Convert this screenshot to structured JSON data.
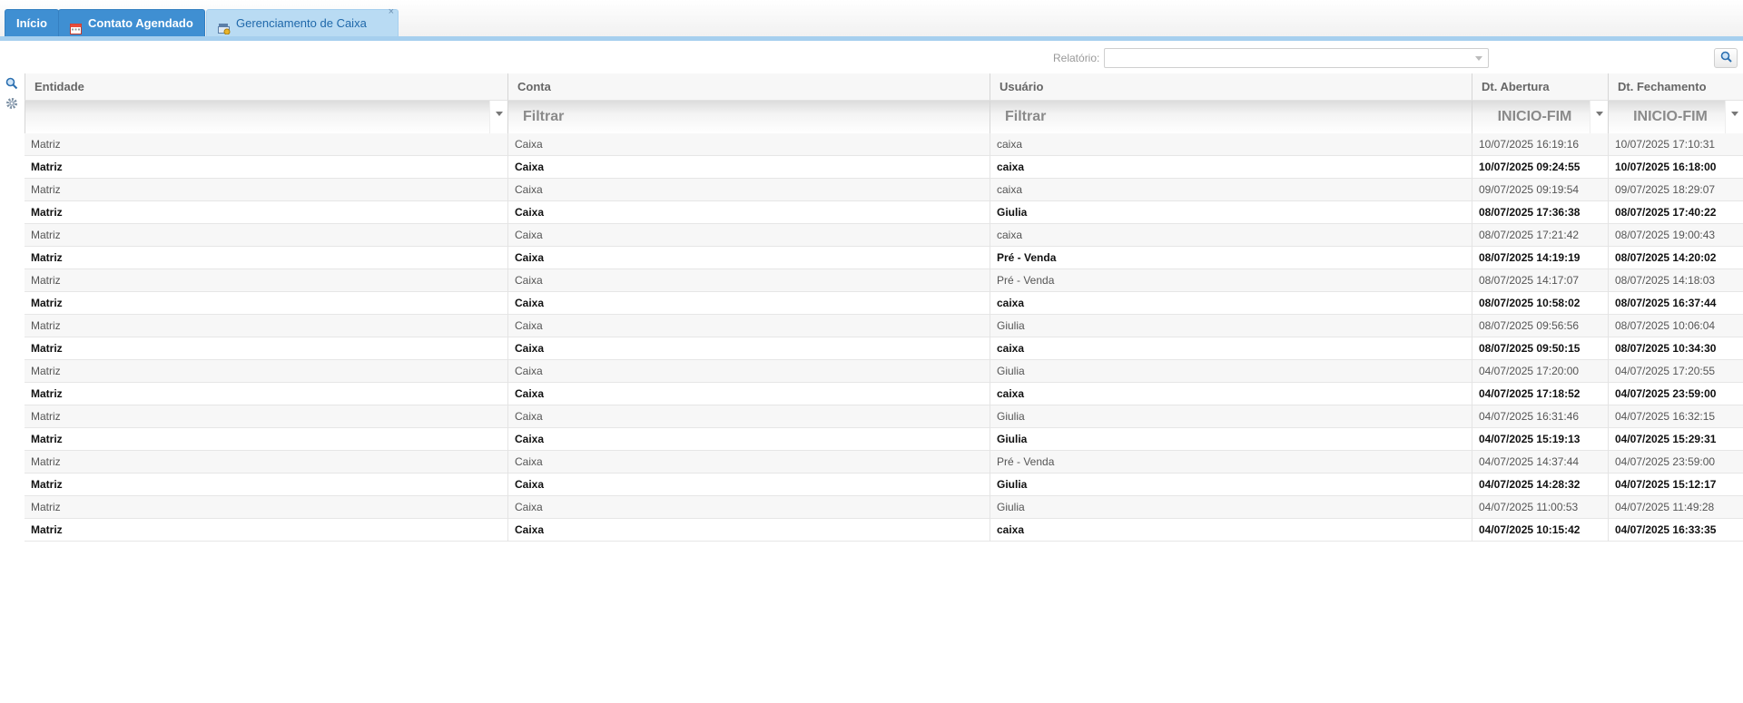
{
  "tabs": [
    {
      "label": "Início",
      "icon": "home"
    },
    {
      "label": "Contato Agendado",
      "icon": "calendar-icon"
    },
    {
      "label": "Gerenciamento de Caixa",
      "icon": "cash-register-icon",
      "close": "×"
    }
  ],
  "toolbar": {
    "relatorio_label": "Relatório:",
    "relatorio_value": ""
  },
  "columns": [
    {
      "key": "entidade",
      "label": "Entidade",
      "filter_placeholder": ""
    },
    {
      "key": "conta",
      "label": "Conta",
      "filter_placeholder": "Filtrar"
    },
    {
      "key": "usuario",
      "label": "Usuário",
      "filter_placeholder": "Filtrar"
    },
    {
      "key": "abertura",
      "label": "Dt. Abertura",
      "filter_placeholder": "INICIO-FIM"
    },
    {
      "key": "fechamento",
      "label": "Dt. Fechamento",
      "filter_placeholder": "INICIO-FIM"
    }
  ],
  "rows": [
    [
      "Matriz",
      "Caixa",
      "caixa",
      "10/07/2025 16:19:16",
      "10/07/2025 17:10:31"
    ],
    [
      "Matriz",
      "Caixa",
      "caixa",
      "10/07/2025 09:24:55",
      "10/07/2025 16:18:00"
    ],
    [
      "Matriz",
      "Caixa",
      "caixa",
      "09/07/2025 09:19:54",
      "09/07/2025 18:29:07"
    ],
    [
      "Matriz",
      "Caixa",
      "Giulia",
      "08/07/2025 17:36:38",
      "08/07/2025 17:40:22"
    ],
    [
      "Matriz",
      "Caixa",
      "caixa",
      "08/07/2025 17:21:42",
      "08/07/2025 19:00:43"
    ],
    [
      "Matriz",
      "Caixa",
      "Pré - Venda",
      "08/07/2025 14:19:19",
      "08/07/2025 14:20:02"
    ],
    [
      "Matriz",
      "Caixa",
      "Pré - Venda",
      "08/07/2025 14:17:07",
      "08/07/2025 14:18:03"
    ],
    [
      "Matriz",
      "Caixa",
      "caixa",
      "08/07/2025 10:58:02",
      "08/07/2025 16:37:44"
    ],
    [
      "Matriz",
      "Caixa",
      "Giulia",
      "08/07/2025 09:56:56",
      "08/07/2025 10:06:04"
    ],
    [
      "Matriz",
      "Caixa",
      "caixa",
      "08/07/2025 09:50:15",
      "08/07/2025 10:34:30"
    ],
    [
      "Matriz",
      "Caixa",
      "Giulia",
      "04/07/2025 17:20:00",
      "04/07/2025 17:20:55"
    ],
    [
      "Matriz",
      "Caixa",
      "caixa",
      "04/07/2025 17:18:52",
      "04/07/2025 23:59:00"
    ],
    [
      "Matriz",
      "Caixa",
      "Giulia",
      "04/07/2025 16:31:46",
      "04/07/2025 16:32:15"
    ],
    [
      "Matriz",
      "Caixa",
      "Giulia",
      "04/07/2025 15:19:13",
      "04/07/2025 15:29:31"
    ],
    [
      "Matriz",
      "Caixa",
      "Pré - Venda",
      "04/07/2025 14:37:44",
      "04/07/2025 23:59:00"
    ],
    [
      "Matriz",
      "Caixa",
      "Giulia",
      "04/07/2025 14:28:32",
      "04/07/2025 15:12:17"
    ],
    [
      "Matriz",
      "Caixa",
      "Giulia",
      "04/07/2025 11:00:53",
      "04/07/2025 11:49:28"
    ],
    [
      "Matriz",
      "Caixa",
      "caixa",
      "04/07/2025 10:15:42",
      "04/07/2025 16:33:35"
    ]
  ],
  "colors": {
    "tab_blue": "#3f8fd2",
    "tab_active": "#b9dbf3",
    "accent_bar": "#a6cfee"
  },
  "icons": {
    "grid_search": "search-icon",
    "grid_settings": "gear-icon",
    "relatorio_search": "search-icon"
  }
}
